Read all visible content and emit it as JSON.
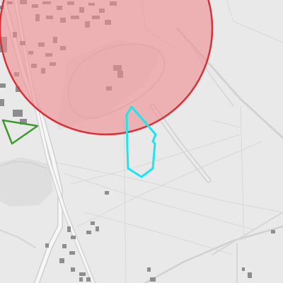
{
  "map": {
    "basemap_style": "light-grey",
    "colors": {
      "background": "#e9e9e9",
      "road_major": "#f6f6f6",
      "road_minor": "#f3f3f3",
      "road_casing": "#cfcfcf",
      "path": "#d6d6d6",
      "building": "#8d8d8d",
      "water_area": "#dedede",
      "buffer_fill": "#f08a8f",
      "buffer_fill_opacity": 0.6,
      "buffer_stroke": "#d6323a",
      "green_polygon_stroke": "#3f9a2d",
      "cyan_polygon_stroke": "#19e6f0"
    },
    "overlays": [
      {
        "name": "circular-buffer",
        "shape": "circle",
        "color": "red"
      },
      {
        "name": "green-polygon",
        "shape": "triangle",
        "color": "green"
      },
      {
        "name": "cyan-polygon",
        "shape": "polygon",
        "color": "cyan"
      }
    ]
  }
}
